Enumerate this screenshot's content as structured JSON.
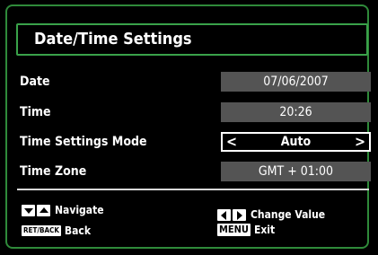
{
  "title": "Date/Time Settings",
  "rows": [
    {
      "label": "Date",
      "value": "07/06/2007"
    },
    {
      "label": "Time",
      "value": "20:26"
    },
    {
      "label": "Time Settings Mode",
      "value": "Auto"
    },
    {
      "label": "Time Zone",
      "value": "GMT + 01:00"
    }
  ],
  "footer": {
    "navigate_label": "Navigate",
    "back_key": "RET/BACK",
    "back_label": "Back",
    "change_value_label": "Change Value",
    "menu_key": "MENU",
    "exit_label": "Exit"
  },
  "colors": {
    "frame": "#2f8a3a",
    "title_border": "#3aa24a",
    "value_bg": "#545454"
  }
}
